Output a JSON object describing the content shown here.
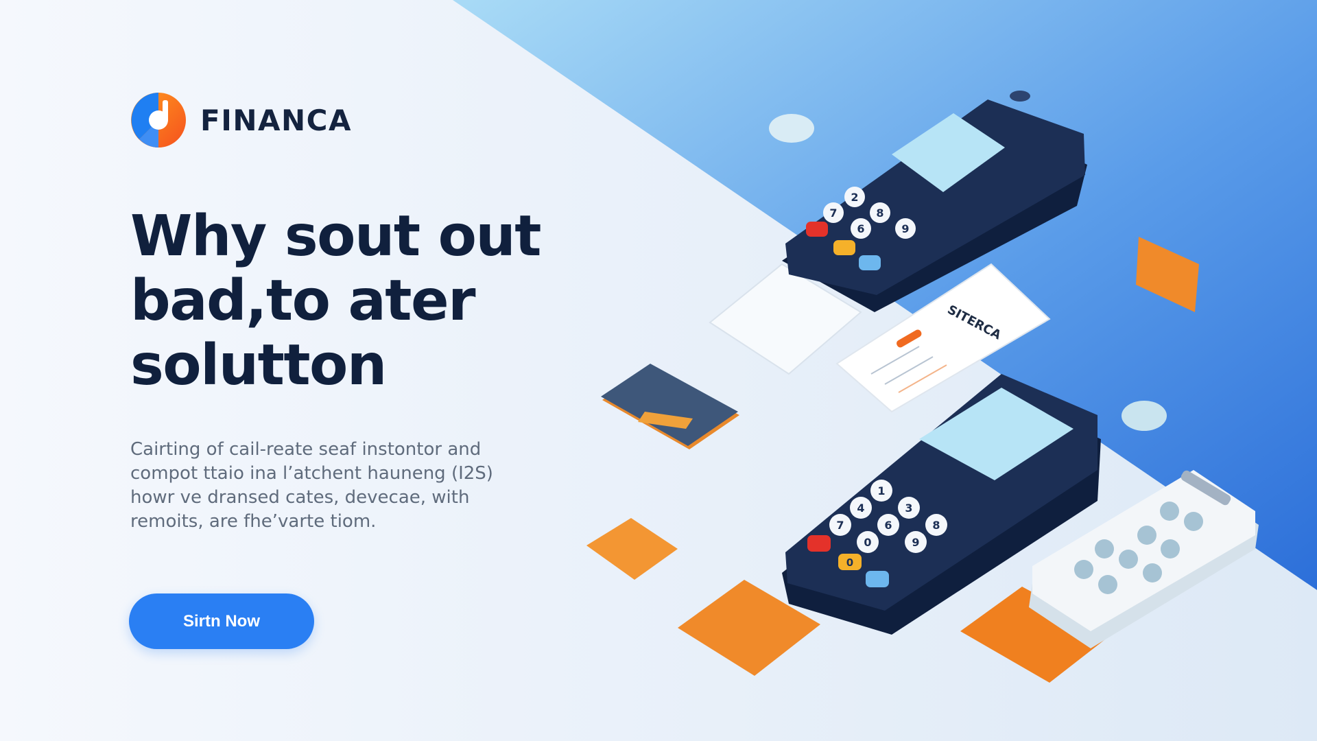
{
  "brand": {
    "name": "FINANCA"
  },
  "hero": {
    "headline_lines": [
      "Why sout out",
      "bad,to ater",
      "solutton"
    ],
    "description_lines": [
      "Cairting of cail-reate seaf instontor and",
      "compot ttaio ina l’atchent hauneng (I2S)",
      "howr ve dransed cates, devecae, with",
      "remoits, are fhe’varte tiom."
    ],
    "cta_label": "Sirtn Now"
  },
  "illustration": {
    "receipt_brand": "SITERCA",
    "keypad_upper": [
      "2",
      "8",
      "7",
      "6",
      "9"
    ],
    "keypad_lower": [
      "1",
      "3",
      "4",
      "6",
      "8",
      "7",
      "0",
      "9",
      "0"
    ]
  },
  "colors": {
    "brand_blue": "#2a7ff3",
    "navy_text": "#10203d",
    "accent_orange": "#f08a2a",
    "terminal_navy": "#1c2f55"
  }
}
